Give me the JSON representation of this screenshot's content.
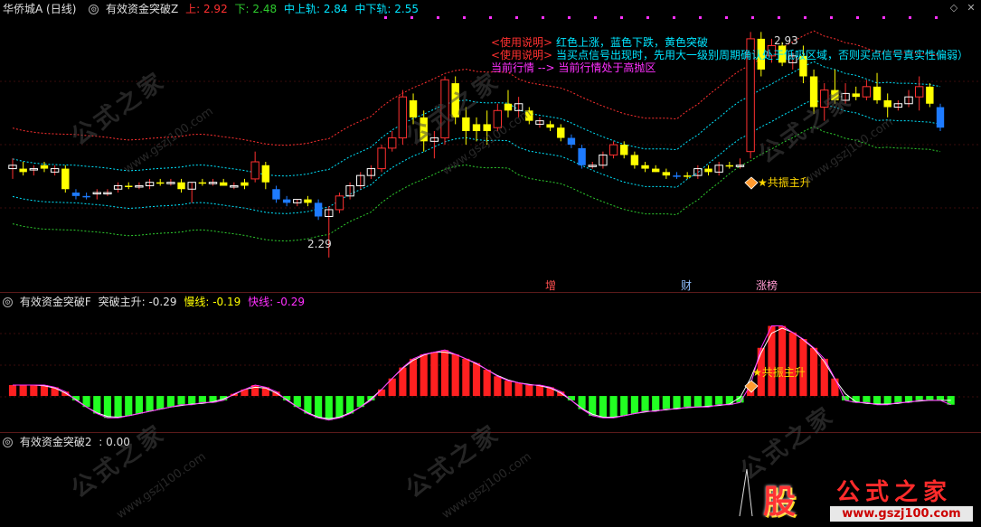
{
  "panel1": {
    "stock": "华侨城A (日线)",
    "indicator": "有效资金突破Z",
    "up_label": "上:",
    "up_value": "2.92",
    "down_label": "下:",
    "down_value": "2.48",
    "mid_up_label": "中上轨:",
    "mid_up_value": "2.84",
    "mid_down_label": "中下轨:",
    "mid_down_value": "2.55",
    "notes": [
      {
        "tag": "<使用说明>",
        "text": "红色上涨，蓝色下跌，黄色突破"
      },
      {
        "tag": "<使用说明>",
        "text": "当买点信号出现时，先用大一级别周期确认处于低吸区域，否则买点信号真实性偏弱）"
      },
      {
        "tag": "当前行情 -->",
        "text": "当前行情处于高抛区"
      }
    ],
    "high_label": "2.93",
    "low_label": "2.29",
    "resonance_label": "★共振主升",
    "event_tags": [
      "增",
      "财",
      "涨榜"
    ]
  },
  "panel2": {
    "indicator": "有效资金突破F",
    "main_label": "突破主升:",
    "main_value": "-0.29",
    "slow_label": "慢线:",
    "slow_value": "-0.19",
    "fast_label": "快线:",
    "fast_value": "-0.29",
    "resonance_label": "★共振主升"
  },
  "panel3": {
    "indicator": "有效资金突破2",
    "value_label": ":",
    "value": "0.00"
  },
  "watermark": {
    "text": "公式之家",
    "url": "www.gszj100.com"
  },
  "logo": {
    "glyph": "股",
    "name": "公式之家",
    "url": "www.gszj100.com"
  },
  "colors": {
    "up": "#ff3030",
    "down": "#1e7bff",
    "breakout": "#ffff00",
    "upper_band": "#ff3030",
    "mid_upper_band": "#00e5ff",
    "mid_lower_band": "#00e5ff",
    "lower_band": "#2ecc2e",
    "histogram_pos": "#ff2020",
    "histogram_neg": "#22ff22"
  },
  "chart_data": {
    "type": "candlestick",
    "price_range": [
      2.25,
      2.98
    ],
    "candles": [
      {
        "o": 2.56,
        "h": 2.58,
        "l": 2.52,
        "c": 2.55,
        "t": "up"
      },
      {
        "o": 2.55,
        "h": 2.57,
        "l": 2.53,
        "c": 2.54,
        "t": "brk"
      },
      {
        "o": 2.55,
        "h": 2.56,
        "l": 2.53,
        "c": 2.55,
        "t": "up"
      },
      {
        "o": 2.56,
        "h": 2.57,
        "l": 2.54,
        "c": 2.55,
        "t": "brk"
      },
      {
        "o": 2.54,
        "h": 2.56,
        "l": 2.53,
        "c": 2.55,
        "t": "up"
      },
      {
        "o": 2.55,
        "h": 2.56,
        "l": 2.48,
        "c": 2.49,
        "t": "brk"
      },
      {
        "o": 2.48,
        "h": 2.49,
        "l": 2.46,
        "c": 2.47,
        "t": "dn"
      },
      {
        "o": 2.47,
        "h": 2.48,
        "l": 2.46,
        "c": 2.47,
        "t": "dn"
      },
      {
        "o": 2.48,
        "h": 2.49,
        "l": 2.46,
        "c": 2.48,
        "t": "up"
      },
      {
        "o": 2.48,
        "h": 2.49,
        "l": 2.47,
        "c": 2.48,
        "t": "up"
      },
      {
        "o": 2.49,
        "h": 2.51,
        "l": 2.48,
        "c": 2.5,
        "t": "up"
      },
      {
        "o": 2.5,
        "h": 2.51,
        "l": 2.49,
        "c": 2.5,
        "t": "brk"
      },
      {
        "o": 2.5,
        "h": 2.51,
        "l": 2.49,
        "c": 2.5,
        "t": "up"
      },
      {
        "o": 2.5,
        "h": 2.52,
        "l": 2.49,
        "c": 2.51,
        "t": "up"
      },
      {
        "o": 2.51,
        "h": 2.52,
        "l": 2.5,
        "c": 2.51,
        "t": "brk"
      },
      {
        "o": 2.51,
        "h": 2.52,
        "l": 2.5,
        "c": 2.51,
        "t": "up"
      },
      {
        "o": 2.51,
        "h": 2.52,
        "l": 2.48,
        "c": 2.49,
        "t": "brk"
      },
      {
        "o": 2.49,
        "h": 2.51,
        "l": 2.45,
        "c": 2.51,
        "t": "up"
      },
      {
        "o": 2.51,
        "h": 2.52,
        "l": 2.5,
        "c": 2.51,
        "t": "brk"
      },
      {
        "o": 2.51,
        "h": 2.52,
        "l": 2.5,
        "c": 2.51,
        "t": "up"
      },
      {
        "o": 2.51,
        "h": 2.52,
        "l": 2.5,
        "c": 2.5,
        "t": "brk"
      },
      {
        "o": 2.5,
        "h": 2.51,
        "l": 2.49,
        "c": 2.5,
        "t": "up"
      },
      {
        "o": 2.5,
        "h": 2.52,
        "l": 2.49,
        "c": 2.51,
        "t": "brk"
      },
      {
        "o": 2.52,
        "h": 2.6,
        "l": 2.51,
        "c": 2.57,
        "t": "up"
      },
      {
        "o": 2.56,
        "h": 2.57,
        "l": 2.49,
        "c": 2.51,
        "t": "brk"
      },
      {
        "o": 2.49,
        "h": 2.5,
        "l": 2.45,
        "c": 2.46,
        "t": "dn"
      },
      {
        "o": 2.46,
        "h": 2.47,
        "l": 2.44,
        "c": 2.45,
        "t": "dn"
      },
      {
        "o": 2.45,
        "h": 2.46,
        "l": 2.44,
        "c": 2.46,
        "t": "up"
      },
      {
        "o": 2.46,
        "h": 2.47,
        "l": 2.44,
        "c": 2.45,
        "t": "brk"
      },
      {
        "o": 2.45,
        "h": 2.46,
        "l": 2.4,
        "c": 2.41,
        "t": "dn"
      },
      {
        "o": 2.41,
        "h": 2.44,
        "l": 2.29,
        "c": 2.43,
        "t": "up"
      },
      {
        "o": 2.43,
        "h": 2.48,
        "l": 2.42,
        "c": 2.47,
        "t": "up"
      },
      {
        "o": 2.47,
        "h": 2.51,
        "l": 2.46,
        "c": 2.5,
        "t": "up"
      },
      {
        "o": 2.5,
        "h": 2.54,
        "l": 2.49,
        "c": 2.53,
        "t": "up"
      },
      {
        "o": 2.53,
        "h": 2.56,
        "l": 2.52,
        "c": 2.55,
        "t": "up"
      },
      {
        "o": 2.55,
        "h": 2.62,
        "l": 2.54,
        "c": 2.61,
        "t": "up"
      },
      {
        "o": 2.61,
        "h": 2.66,
        "l": 2.6,
        "c": 2.64,
        "t": "up"
      },
      {
        "o": 2.64,
        "h": 2.78,
        "l": 2.62,
        "c": 2.76,
        "t": "up"
      },
      {
        "o": 2.75,
        "h": 2.77,
        "l": 2.68,
        "c": 2.7,
        "t": "brk"
      },
      {
        "o": 2.7,
        "h": 2.72,
        "l": 2.6,
        "c": 2.63,
        "t": "brk"
      },
      {
        "o": 2.63,
        "h": 2.66,
        "l": 2.58,
        "c": 2.64,
        "t": "up"
      },
      {
        "o": 2.64,
        "h": 2.82,
        "l": 2.62,
        "c": 2.81,
        "t": "up"
      },
      {
        "o": 2.8,
        "h": 2.82,
        "l": 2.68,
        "c": 2.7,
        "t": "brk"
      },
      {
        "o": 2.7,
        "h": 2.73,
        "l": 2.62,
        "c": 2.66,
        "t": "brk"
      },
      {
        "o": 2.66,
        "h": 2.7,
        "l": 2.63,
        "c": 2.68,
        "t": "brk"
      },
      {
        "o": 2.68,
        "h": 2.72,
        "l": 2.62,
        "c": 2.66,
        "t": "brk"
      },
      {
        "o": 2.67,
        "h": 2.74,
        "l": 2.66,
        "c": 2.72,
        "t": "up"
      },
      {
        "o": 2.72,
        "h": 2.78,
        "l": 2.7,
        "c": 2.74,
        "t": "brk"
      },
      {
        "o": 2.74,
        "h": 2.76,
        "l": 2.7,
        "c": 2.72,
        "t": "up"
      },
      {
        "o": 2.72,
        "h": 2.73,
        "l": 2.68,
        "c": 2.69,
        "t": "brk"
      },
      {
        "o": 2.69,
        "h": 2.7,
        "l": 2.67,
        "c": 2.68,
        "t": "up"
      },
      {
        "o": 2.68,
        "h": 2.69,
        "l": 2.66,
        "c": 2.67,
        "t": "brk"
      },
      {
        "o": 2.67,
        "h": 2.68,
        "l": 2.63,
        "c": 2.64,
        "t": "brk"
      },
      {
        "o": 2.64,
        "h": 2.65,
        "l": 2.61,
        "c": 2.62,
        "t": "dn"
      },
      {
        "o": 2.61,
        "h": 2.62,
        "l": 2.55,
        "c": 2.56,
        "t": "dn"
      },
      {
        "o": 2.56,
        "h": 2.57,
        "l": 2.55,
        "c": 2.56,
        "t": "up"
      },
      {
        "o": 2.56,
        "h": 2.6,
        "l": 2.55,
        "c": 2.59,
        "t": "up"
      },
      {
        "o": 2.59,
        "h": 2.63,
        "l": 2.58,
        "c": 2.62,
        "t": "up"
      },
      {
        "o": 2.62,
        "h": 2.63,
        "l": 2.58,
        "c": 2.59,
        "t": "brk"
      },
      {
        "o": 2.59,
        "h": 2.6,
        "l": 2.55,
        "c": 2.56,
        "t": "brk"
      },
      {
        "o": 2.56,
        "h": 2.57,
        "l": 2.54,
        "c": 2.55,
        "t": "brk"
      },
      {
        "o": 2.55,
        "h": 2.56,
        "l": 2.54,
        "c": 2.54,
        "t": "brk"
      },
      {
        "o": 2.54,
        "h": 2.55,
        "l": 2.52,
        "c": 2.53,
        "t": "brk"
      },
      {
        "o": 2.53,
        "h": 2.54,
        "l": 2.52,
        "c": 2.53,
        "t": "dn"
      },
      {
        "o": 2.53,
        "h": 2.54,
        "l": 2.52,
        "c": 2.53,
        "t": "brk"
      },
      {
        "o": 2.53,
        "h": 2.56,
        "l": 2.52,
        "c": 2.55,
        "t": "up"
      },
      {
        "o": 2.55,
        "h": 2.56,
        "l": 2.53,
        "c": 2.54,
        "t": "brk"
      },
      {
        "o": 2.54,
        "h": 2.57,
        "l": 2.53,
        "c": 2.56,
        "t": "up"
      },
      {
        "o": 2.56,
        "h": 2.57,
        "l": 2.55,
        "c": 2.56,
        "t": "brk"
      },
      {
        "o": 2.56,
        "h": 2.58,
        "l": 2.55,
        "c": 2.56,
        "t": "up"
      },
      {
        "o": 2.6,
        "h": 2.95,
        "l": 2.58,
        "c": 2.93,
        "t": "up"
      },
      {
        "o": 2.93,
        "h": 2.95,
        "l": 2.82,
        "c": 2.84,
        "t": "brk"
      },
      {
        "o": 2.88,
        "h": 2.93,
        "l": 2.86,
        "c": 2.91,
        "t": "up"
      },
      {
        "o": 2.91,
        "h": 2.92,
        "l": 2.85,
        "c": 2.86,
        "t": "brk"
      },
      {
        "o": 2.86,
        "h": 2.89,
        "l": 2.84,
        "c": 2.88,
        "t": "up"
      },
      {
        "o": 2.88,
        "h": 2.91,
        "l": 2.8,
        "c": 2.82,
        "t": "brk"
      },
      {
        "o": 2.82,
        "h": 2.84,
        "l": 2.71,
        "c": 2.73,
        "t": "brk"
      },
      {
        "o": 2.73,
        "h": 2.8,
        "l": 2.69,
        "c": 2.78,
        "t": "up"
      },
      {
        "o": 2.78,
        "h": 2.84,
        "l": 2.74,
        "c": 2.75,
        "t": "brk"
      },
      {
        "o": 2.75,
        "h": 2.8,
        "l": 2.74,
        "c": 2.77,
        "t": "up"
      },
      {
        "o": 2.77,
        "h": 2.79,
        "l": 2.75,
        "c": 2.76,
        "t": "brk"
      },
      {
        "o": 2.76,
        "h": 2.81,
        "l": 2.75,
        "c": 2.79,
        "t": "up"
      },
      {
        "o": 2.79,
        "h": 2.83,
        "l": 2.74,
        "c": 2.75,
        "t": "brk"
      },
      {
        "o": 2.75,
        "h": 2.77,
        "l": 2.7,
        "c": 2.73,
        "t": "brk"
      },
      {
        "o": 2.73,
        "h": 2.75,
        "l": 2.72,
        "c": 2.74,
        "t": "up"
      },
      {
        "o": 2.74,
        "h": 2.78,
        "l": 2.73,
        "c": 2.76,
        "t": "up"
      },
      {
        "o": 2.76,
        "h": 2.82,
        "l": 2.72,
        "c": 2.79,
        "t": "up"
      },
      {
        "o": 2.79,
        "h": 2.8,
        "l": 2.73,
        "c": 2.74,
        "t": "brk"
      },
      {
        "o": 2.73,
        "h": 2.74,
        "l": 2.66,
        "c": 2.67,
        "t": "dn"
      }
    ],
    "histogram": [
      0.05,
      0.05,
      0.05,
      0.05,
      0.04,
      0.02,
      -0.02,
      -0.05,
      -0.08,
      -0.1,
      -0.1,
      -0.09,
      -0.08,
      -0.07,
      -0.06,
      -0.05,
      -0.04,
      -0.04,
      -0.03,
      -0.03,
      -0.02,
      0.01,
      0.03,
      0.05,
      0.04,
      0.02,
      -0.02,
      -0.05,
      -0.08,
      -0.1,
      -0.11,
      -0.1,
      -0.08,
      -0.05,
      -0.02,
      0.03,
      0.08,
      0.13,
      0.17,
      0.19,
      0.2,
      0.21,
      0.19,
      0.17,
      0.15,
      0.12,
      0.09,
      0.07,
      0.06,
      0.05,
      0.05,
      0.04,
      0.02,
      -0.02,
      -0.06,
      -0.09,
      -0.1,
      -0.1,
      -0.09,
      -0.08,
      -0.07,
      -0.07,
      -0.06,
      -0.06,
      -0.05,
      -0.05,
      -0.05,
      -0.04,
      -0.04,
      -0.03,
      0.05,
      0.22,
      0.32,
      0.32,
      0.29,
      0.26,
      0.22,
      0.17,
      0.08,
      -0.02,
      -0.03,
      -0.03,
      -0.04,
      -0.04,
      -0.03,
      -0.03,
      -0.02,
      -0.02,
      -0.02,
      -0.04
    ],
    "histogram_range": [
      -0.14,
      0.38
    ]
  }
}
